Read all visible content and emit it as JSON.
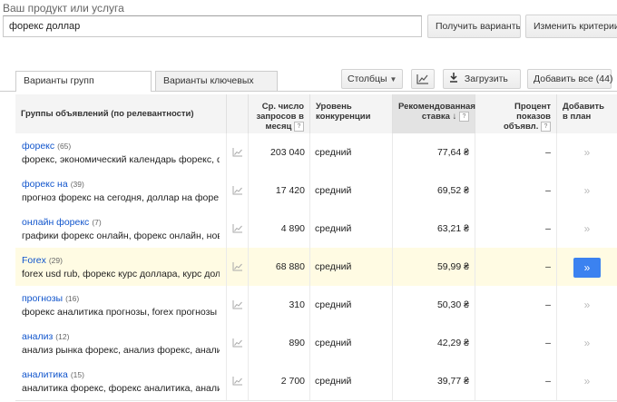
{
  "header": {
    "label": "Ваш продукт или услуга",
    "search_value": "форекс доллар",
    "get_ideas": "Получить варианты",
    "modify_criteria": "Изменить критерии п"
  },
  "tabs": [
    "Варианты групп объявлений",
    "Варианты ключевых слов"
  ],
  "toolbar": {
    "columns": "Столбцы",
    "download": "Загрузить",
    "add_all": "Добавить все (44)"
  },
  "columns": {
    "group": "Группы объявлений (по релевантности)",
    "volume": "Ср. число запросов в месяц",
    "competition": "Уровень конкуренции",
    "bid": "Рекомендованная ставка",
    "share": "Процент показов объявл.",
    "add": "Добавить в план",
    "help": "?",
    "sort_arrow": "↓"
  },
  "icons": {
    "trend": "trend-chart-icon",
    "add": "double-chevron-icon"
  },
  "colors": {
    "link": "#1155cc",
    "highlight_row": "#fffbe3",
    "add_button": "#3b82f0"
  },
  "rows": [
    {
      "name": "форекс",
      "count": "(65)",
      "keywords": "форекс, экономический календарь форекс, ф",
      "volume": "203 040",
      "competition": "средний",
      "bid": "77,64 ₴",
      "share": "–",
      "add": "»"
    },
    {
      "name": "форекс на",
      "count": "(39)",
      "keywords": "прогноз форекс на сегодня, доллар на форе",
      "volume": "17 420",
      "competition": "средний",
      "bid": "69,52 ₴",
      "share": "–",
      "add": "»"
    },
    {
      "name": "онлайн форекс",
      "count": "(7)",
      "keywords": "графики форекс онлайн, форекс онлайн, нов",
      "volume": "4 890",
      "competition": "средний",
      "bid": "63,21 ₴",
      "share": "–",
      "add": "»"
    },
    {
      "name": "Forex",
      "count": "(29)",
      "keywords": "forex usd rub, форекс курс доллара, курс дол",
      "volume": "68 880",
      "competition": "средний",
      "bid": "59,99 ₴",
      "share": "–",
      "add": "»"
    },
    {
      "name": "прогнозы",
      "count": "(16)",
      "keywords": "форекс аналитика прогнозы, forex прогнозы",
      "volume": "310",
      "competition": "средний",
      "bid": "50,30 ₴",
      "share": "–",
      "add": "»"
    },
    {
      "name": "анализ",
      "count": "(12)",
      "keywords": "анализ рынка форекс, анализ форекс, анали",
      "volume": "890",
      "competition": "средний",
      "bid": "42,29 ₴",
      "share": "–",
      "add": "»"
    },
    {
      "name": "аналитика",
      "count": "(15)",
      "keywords": "аналитика форекс, форекс аналитика, анали",
      "volume": "2 700",
      "competition": "средний",
      "bid": "39,77 ₴",
      "share": "–",
      "add": "»"
    }
  ]
}
